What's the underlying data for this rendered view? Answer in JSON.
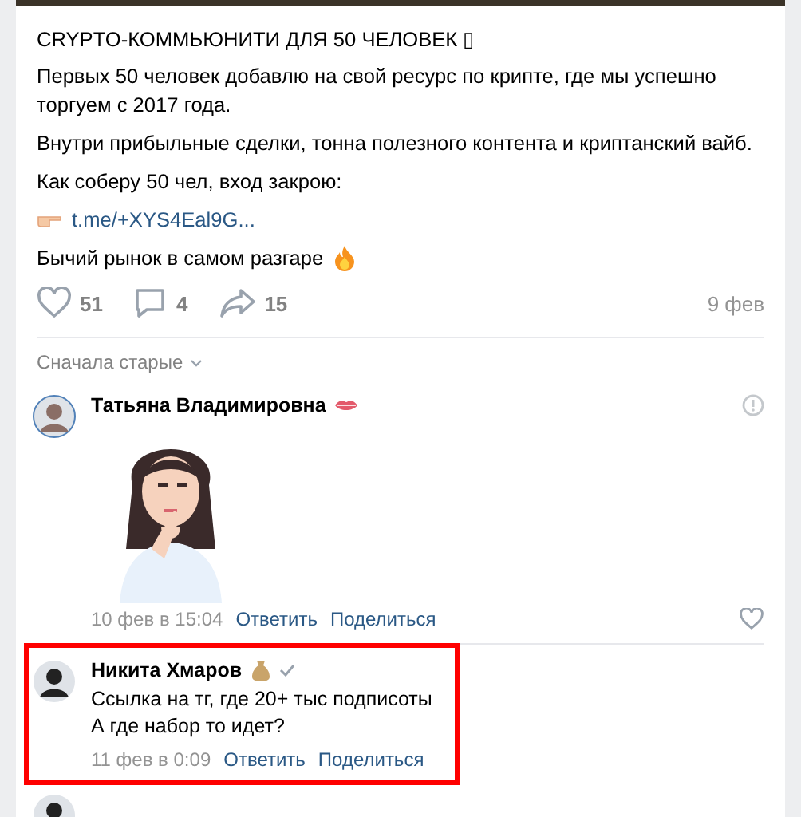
{
  "post": {
    "title": "CRYPTO-КОММЬЮНИТИ ДЛЯ 50 ЧЕЛОВЕК ▯",
    "paragraphs": [
      {
        "kind": "text",
        "text": "Первых 50 человек добавлю на свой ресурс по крипте, где мы успешно торгуем с 2017 года."
      },
      {
        "kind": "text",
        "text": "Внутри прибыльные сделки, тонна полезного контента и криптанский вайб."
      },
      {
        "kind": "text",
        "text": "Как соберу 50 чел, вход закрою:"
      },
      {
        "kind": "link",
        "text": "t.me/+XYS4Eal9G..."
      },
      {
        "kind": "fire",
        "text": "Бычий рынок в самом разгаре"
      }
    ],
    "likes": "51",
    "comments": "4",
    "shares": "15",
    "date": "9 фев"
  },
  "sort": "Сначала старые",
  "comments": [
    {
      "author": "Татьяна Владимировна",
      "badge": {
        "kind": "lips"
      },
      "kind": "sticker",
      "date": "10 фев в 15:04",
      "reply": "Ответить",
      "share": "Поделиться",
      "highlighted": false
    },
    {
      "author": "Никита Хмаров",
      "badge": {
        "kind": "moneybag"
      },
      "kind": "text",
      "lines": [
        "Ссылка на тг, где 20+ тыс подписоты",
        "А где набор то идет?"
      ],
      "date": "11 фев в 0:09",
      "reply": "Ответить",
      "share": "Поделиться",
      "highlighted": true
    }
  ]
}
